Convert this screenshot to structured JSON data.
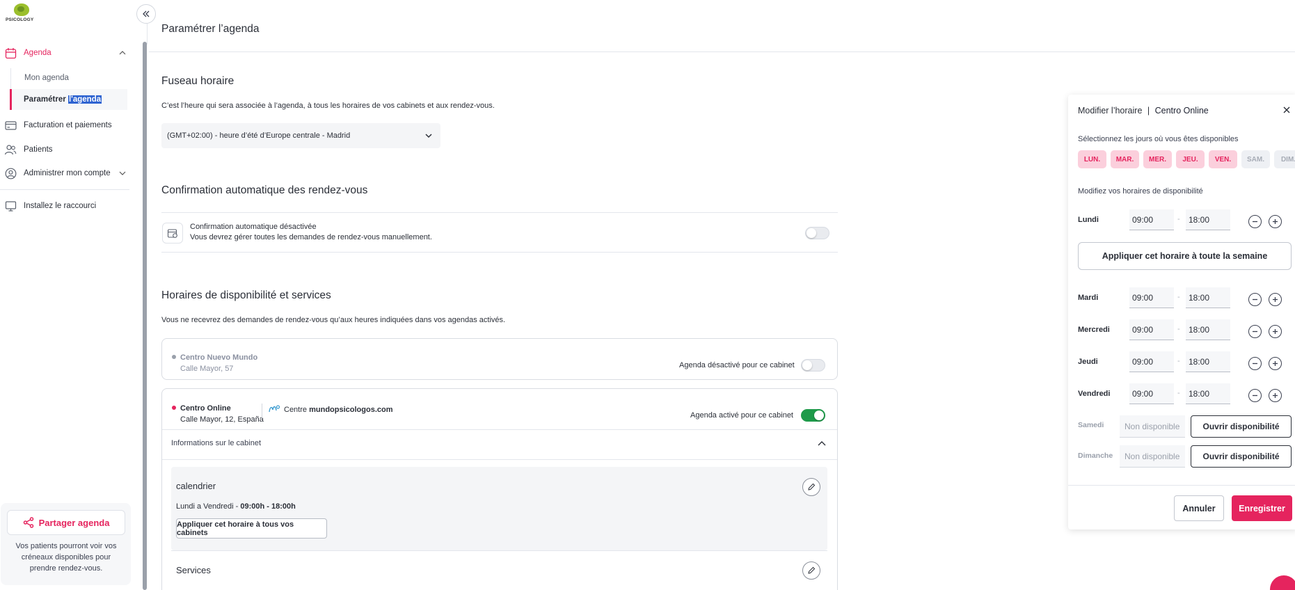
{
  "brand": {
    "logo_text": "PSICOLOGY",
    "accent": "#e5245e",
    "success": "#1e9a4a"
  },
  "sidebar": {
    "agenda": "Agenda",
    "mon_agenda": "Mon agenda",
    "parametrer_prefix": "Paramétrer ",
    "parametrer_selected": "l'agenda",
    "facturation": "Facturation et paiements",
    "patients": "Patients",
    "administrer": "Administrer mon compte",
    "raccourci": "Installez le raccourci",
    "share_button": "Partager agenda",
    "share_note": "Vos patients pourront voir vos créneaux disponibles pour prendre rendez-vous."
  },
  "main": {
    "page_title": "Paramétrer l’agenda",
    "timezone": {
      "title": "Fuseau horaire",
      "desc": "C’est l’heure qui sera associée à l’agenda, à tous les horaires de vos cabinets et aux rendez-vous.",
      "value": "(GMT+02:00) - heure d’été d’Europe centrale - Madrid"
    },
    "confirmation": {
      "title": "Confirmation automatique des rendez-vous",
      "row_title": "Confirmation automatique désactivée",
      "row_desc": "Vous devrez gérer toutes les demandes de rendez-vous manuellement.",
      "enabled": false
    },
    "availability": {
      "title": "Horaires de disponibilité et services",
      "desc": "Vous ne recevrez des demandes de rendez-vous qu’aux heures indiquées dans vos agendas activés."
    },
    "cabinets": [
      {
        "name": "Centro Nuevo Mundo",
        "address": "Calle Mayor, 57",
        "status": "Agenda désactivé pour ce cabinet",
        "enabled": false
      },
      {
        "name": "Centro Online",
        "address": "Calle Mayor, 12, España",
        "status": "Agenda activé pour ce cabinet",
        "enabled": true,
        "centre_prefix": "Centre",
        "centre_site": "mundopsicologos.com",
        "info_label": "Informations sur le cabinet",
        "calendar_title": "calendrier",
        "schedule_days": "Lundi a Vendredi - ",
        "schedule_hours": "09:00h - 18:00h",
        "apply_all": "Appliquer cet horaire à tous vos cabinets",
        "services": "Services"
      }
    ]
  },
  "panel": {
    "title": "Modifier l’horaire",
    "separator": "|",
    "cabinet": "Centro Online",
    "select_days": "Sélectionnez les jours où vous êtes disponibles",
    "days": [
      {
        "label": "LUN.",
        "on": true
      },
      {
        "label": "MAR.",
        "on": true
      },
      {
        "label": "MER.",
        "on": true
      },
      {
        "label": "JEU.",
        "on": true
      },
      {
        "label": "VEN.",
        "on": true
      },
      {
        "label": "SAM.",
        "on": false
      },
      {
        "label": "DIM.",
        "on": false
      }
    ],
    "modify_hours": "Modifiez vos horaires de disponibilité",
    "apply_week": "Appliquer cet horaire à toute la semaine",
    "dash": "-",
    "schedule": [
      {
        "day": "Lundi",
        "from": "09:00",
        "to": "18:00"
      },
      {
        "day": "Mardi",
        "from": "09:00",
        "to": "18:00"
      },
      {
        "day": "Mercredi",
        "from": "09:00",
        "to": "18:00"
      },
      {
        "day": "Jeudi",
        "from": "09:00",
        "to": "18:00"
      },
      {
        "day": "Vendredi",
        "from": "09:00",
        "to": "18:00"
      }
    ],
    "unavailable": [
      {
        "day": "Samedi",
        "value": "Non disponible",
        "button": "Ouvrir disponibilité"
      },
      {
        "day": "Dimanche",
        "value": "Non disponible",
        "button": "Ouvrir disponibilité"
      }
    ],
    "cancel": "Annuler",
    "save": "Enregistrer"
  }
}
